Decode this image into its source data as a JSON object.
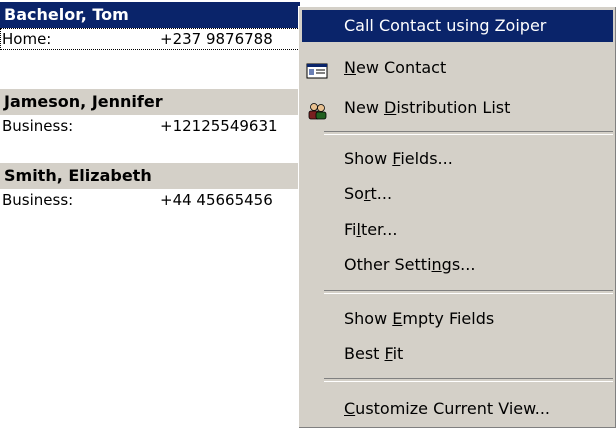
{
  "contacts": [
    {
      "name": "Bachelor, Tom",
      "phone_label": "Home:",
      "phone": "+237 9876788"
    },
    {
      "name": "Jameson, Jennifer",
      "phone_label": "Business:",
      "phone": "+12125549631"
    },
    {
      "name": "Smith, Elizabeth",
      "phone_label": "Business:",
      "phone": "+44 45665456"
    }
  ],
  "menu": {
    "items": [
      {
        "label": "Call Contact using Zoiper",
        "pre": "Call Contact using Zoiper",
        "acc": "",
        "post": ""
      },
      {
        "label": "New Contact",
        "pre": "",
        "acc": "N",
        "post": "ew Contact",
        "icon": "contact-card-icon"
      },
      {
        "label": "New Distribution List",
        "pre": "New ",
        "acc": "D",
        "post": "istribution List",
        "icon": "distribution-list-icon"
      },
      {
        "label": "Show Fields...",
        "pre": "Show ",
        "acc": "F",
        "post": "ields..."
      },
      {
        "label": "Sort...",
        "pre": "So",
        "acc": "r",
        "post": "t..."
      },
      {
        "label": "Filter...",
        "pre": "Fi",
        "acc": "l",
        "post": "ter..."
      },
      {
        "label": "Other Settings...",
        "pre": "Other Setti",
        "acc": "n",
        "post": "gs..."
      },
      {
        "label": "Show Empty Fields",
        "pre": "Show ",
        "acc": "E",
        "post": "mpty Fields"
      },
      {
        "label": "Best Fit",
        "pre": "Best ",
        "acc": "F",
        "post": "it"
      },
      {
        "label": "Customize Current View...",
        "pre": "",
        "acc": "C",
        "post": "ustomize Current View..."
      }
    ]
  },
  "colors": {
    "highlight": "#0a246a",
    "menu_bg": "#d4d0c8",
    "card_header": "#d4d0c8"
  }
}
